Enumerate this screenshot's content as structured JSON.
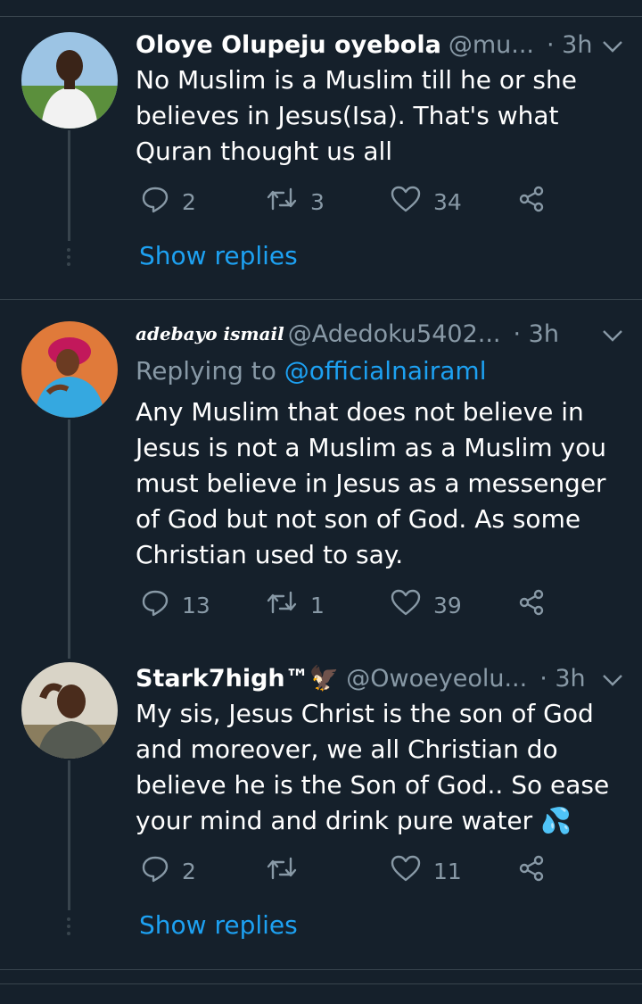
{
  "tweets": [
    {
      "name": "Oloye Olupeju oyebola",
      "handle": "@mu...",
      "time": "· 3h",
      "text": "No Muslim is a Muslim till he or she believes in Jesus(Isa). That's what Quran thought us all",
      "replies": "2",
      "retweets": "3",
      "likes": "34",
      "show_replies": "Show replies"
    },
    {
      "name": "adebayo ismail",
      "handle": "@Adedoku5402...",
      "time": "· 3h",
      "replying_label": "Replying to",
      "replying_to": "@officialnairaml",
      "text": "Any Muslim that does not believe in Jesus is not a Muslim as a Muslim you must believe in Jesus as a messenger of God but not son of God. As some Christian used to say.",
      "replies": "13",
      "retweets": "1",
      "likes": "39"
    },
    {
      "name": "Stark7high™🦅",
      "handle": "@Owoeyeolu...",
      "time": "· 3h",
      "text": "My sis, Jesus Christ is the son of God and moreover, we all Christian do believe he is the Son of God.. So ease your mind and drink pure water 💦",
      "replies": "2",
      "retweets": "",
      "likes": "11",
      "show_replies": "Show replies"
    }
  ],
  "colors": {
    "background": "#15202b",
    "divider": "#38444d",
    "muted": "#8899a6",
    "accent": "#1da1f2"
  },
  "icons": [
    "reply-icon",
    "retweet-icon",
    "like-icon",
    "share-icon",
    "chevron-down-icon"
  ]
}
